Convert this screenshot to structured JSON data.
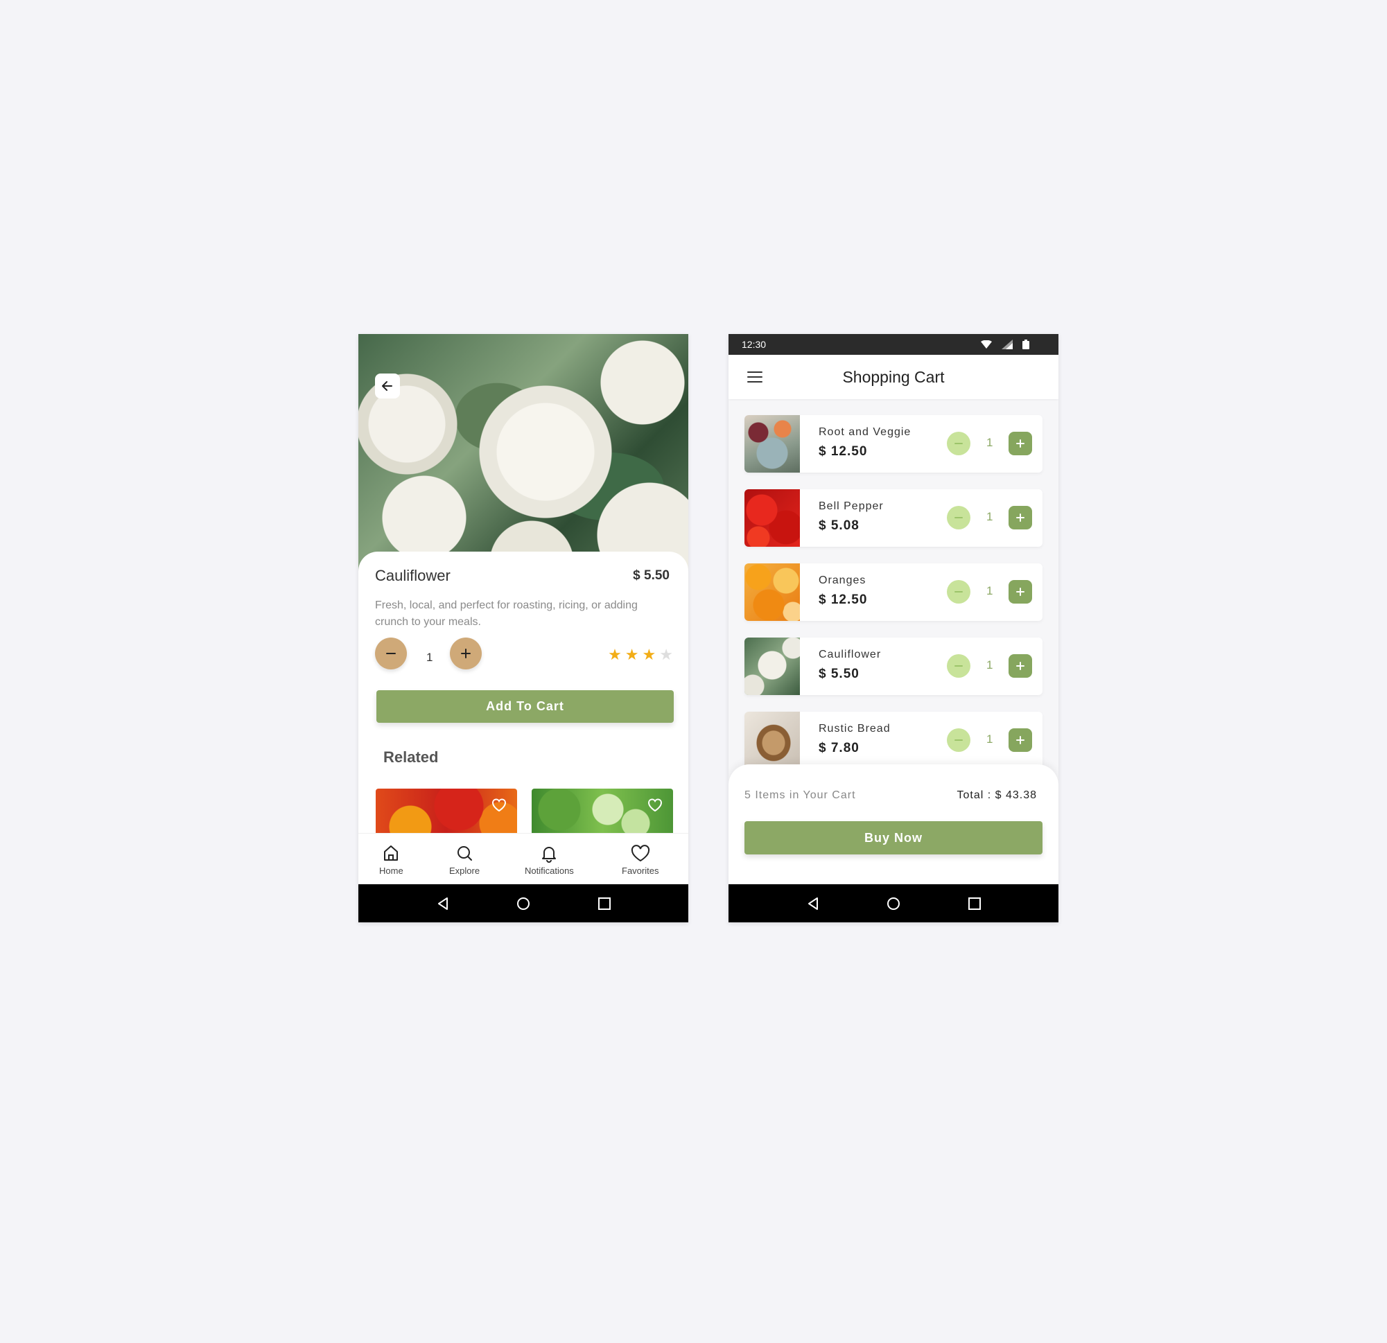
{
  "product": {
    "name": "Cauliflower",
    "price": "$ 5.50",
    "description": "Fresh, local, and perfect for roasting, ricing, or adding crunch to your meals.",
    "quantity": "1",
    "rating": 3,
    "rating_max": 4,
    "add_to_cart_label": "Add To Cart",
    "related_title": "Related",
    "related": [
      {
        "name": "bell-peppers"
      },
      {
        "name": "green-vegetables"
      }
    ]
  },
  "bottom_nav": [
    {
      "label": "Home",
      "icon": "home-icon"
    },
    {
      "label": "Explore",
      "icon": "search-icon"
    },
    {
      "label": "Notifications",
      "icon": "bell-icon"
    },
    {
      "label": "Favorites",
      "icon": "heart-icon"
    }
  ],
  "status_bar": {
    "time": "12:30"
  },
  "cart": {
    "title": "Shopping Cart",
    "items": [
      {
        "name": "Root and Veggie",
        "price": "$ 12.50",
        "quantity": "1"
      },
      {
        "name": "Bell Pepper",
        "price": "$ 5.08",
        "quantity": "1"
      },
      {
        "name": "Oranges",
        "price": "$ 12.50",
        "quantity": "1"
      },
      {
        "name": "Cauliflower",
        "price": "$ 5.50",
        "quantity": "1"
      },
      {
        "name": "Rustic Bread",
        "price": "$ 7.80",
        "quantity": "1"
      }
    ],
    "items_count_text": "5 Items in Your Cart",
    "total_text": "Total : $ 43.38",
    "buy_label": "Buy Now"
  },
  "colors": {
    "accent_green": "#8ca865",
    "light_green": "#c8e39a",
    "tan": "#cfa978",
    "star": "#f2ad17"
  }
}
